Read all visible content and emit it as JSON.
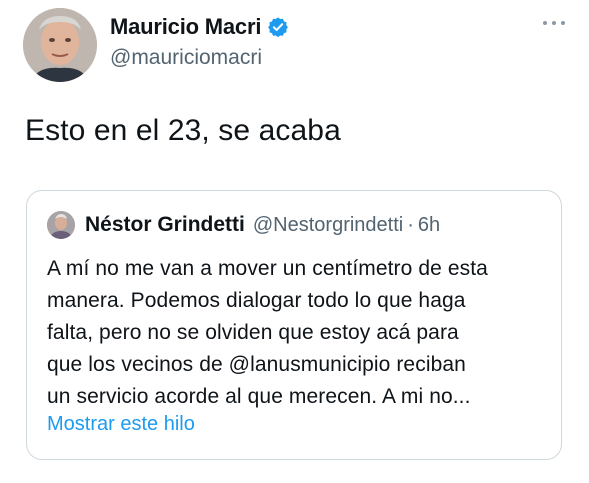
{
  "tweet": {
    "author": {
      "name": "Mauricio Macri",
      "handle": "@mauriciomacri",
      "verified_color": "#1d9bf0"
    },
    "text": "Esto en el 23, se acaba",
    "more_icon": "more-horizontal-icon"
  },
  "quote": {
    "author": {
      "name": "Néstor Grindetti",
      "handle": "@Nestorgrindetti",
      "separator": "·",
      "time": "6h"
    },
    "text_lines": [
      "A mí no me van a mover un centímetro de esta",
      "manera. Podemos dialogar todo lo que haga",
      "falta, pero no se olviden que estoy acá para",
      "que los vecinos de @lanusmunicipio reciban",
      "un servicio acorde al que merecen. A mi no..."
    ],
    "show_thread_label": "Mostrar este hilo",
    "link_color": "#1d9bf0"
  },
  "colors": {
    "text_primary": "#0f1419",
    "text_secondary": "#536471",
    "border": "#cfd9de"
  }
}
